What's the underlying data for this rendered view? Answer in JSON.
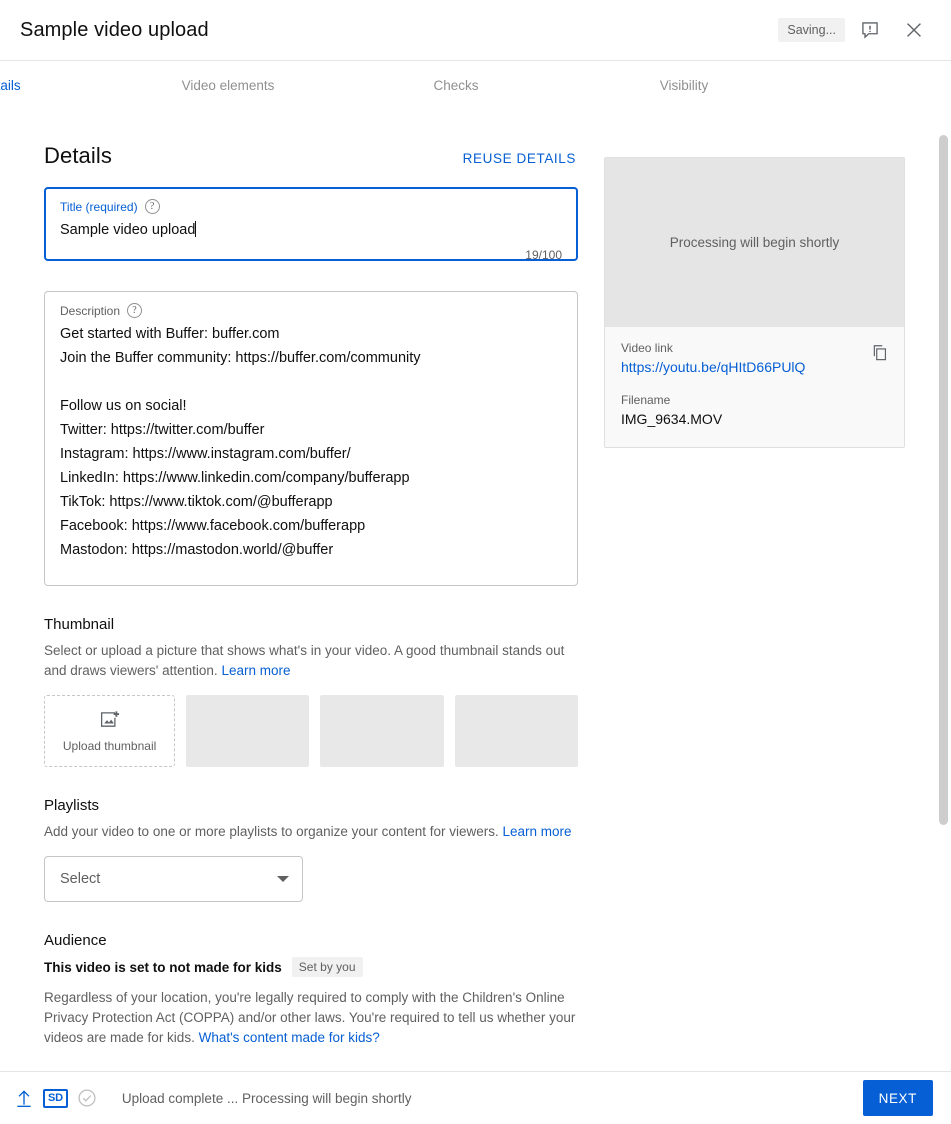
{
  "header": {
    "title": "Sample video upload",
    "saving_label": "Saving...",
    "feedback_icon": "feedback-icon",
    "close_icon": "close-icon"
  },
  "stepper": {
    "steps": [
      {
        "label": "Details",
        "active": true
      },
      {
        "label": "Video elements",
        "active": false
      },
      {
        "label": "Checks",
        "active": false
      },
      {
        "label": "Visibility",
        "active": false
      }
    ]
  },
  "details": {
    "heading": "Details",
    "reuse_label": "REUSE DETAILS",
    "title_field": {
      "label": "Title (required)",
      "value": "Sample video upload",
      "counter": "19/100",
      "help_glyph": "?"
    },
    "description_field": {
      "label": "Description",
      "value": "Get started with Buffer: buffer.com\nJoin the Buffer community: https://buffer.com/community\n\nFollow us on social!\nTwitter: https://twitter.com/buffer\nInstagram: https://www.instagram.com/buffer/\nLinkedIn: https://www.linkedin.com/company/bufferapp\nTikTok: https://www.tiktok.com/@bufferapp\nFacebook: https://www.facebook.com/bufferapp\nMastodon: https://mastodon.world/@buffer",
      "help_glyph": "?"
    }
  },
  "preview": {
    "processing_text": "Processing will begin shortly",
    "video_link_label": "Video link",
    "video_link": "https://youtu.be/qHItD66PUlQ",
    "filename_label": "Filename",
    "filename": "IMG_9634.MOV",
    "copy_icon": "copy-icon"
  },
  "thumbnail": {
    "title": "Thumbnail",
    "description": "Select or upload a picture that shows what's in your video. A good thumbnail stands out and draws viewers' attention.",
    "learn_more": "Learn more",
    "upload_label": "Upload thumbnail",
    "slots": 3
  },
  "playlists": {
    "title": "Playlists",
    "description": "Add your video to one or more playlists to organize your content for viewers.",
    "learn_more": "Learn more",
    "select_value": "Select"
  },
  "audience": {
    "title": "Audience",
    "status": "This video is set to not made for kids",
    "set_by_chip": "Set by you",
    "description": "Regardless of your location, you're legally required to comply with the Children's Online Privacy Protection Act (COPPA) and/or other laws. You're required to tell us whether your videos are made for kids.",
    "learn_link": "What's content made for kids?"
  },
  "footer": {
    "upload_icon": "upload-arrow-icon",
    "quality_badge": "SD",
    "check_icon": "check-circle-icon",
    "status": "Upload complete ... Processing will begin shortly",
    "next_label": "NEXT"
  },
  "colors": {
    "accent": "#065fd4",
    "text_primary": "#0f0f0f",
    "text_secondary": "#606060",
    "border": "#c6c6c6",
    "panel_bg": "#f9f9f9",
    "placeholder_bg": "#e5e5e5"
  }
}
